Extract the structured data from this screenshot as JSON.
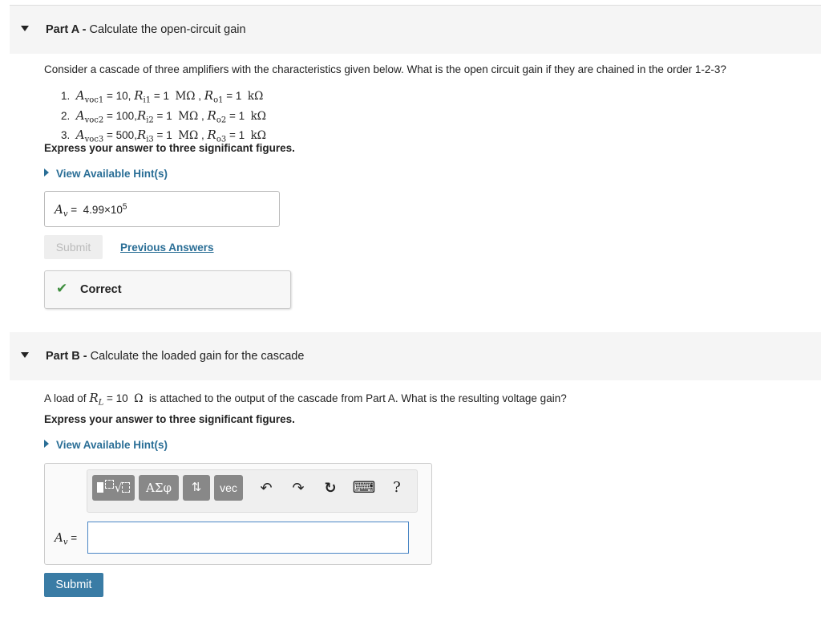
{
  "partA": {
    "label": "Part A",
    "sep": " - ",
    "title": "Calculate the open-circuit gain",
    "question": "Consider a cascade of three amplifiers with the characteristics given below. What is the open circuit gain if they are chained in the order 1-2-3?",
    "items": [
      {
        "num": "1.",
        "avoc_sub": "voc1",
        "avoc_val": "10,",
        "ri_sub": "i1",
        "ri_val": "1",
        "ri_unit": "MΩ",
        "ro_sub": "o1",
        "ro_val": "1",
        "ro_unit": "kΩ"
      },
      {
        "num": "2.",
        "avoc_sub": "voc2",
        "avoc_val": "100,",
        "ri_sub": "i2",
        "ri_val": "1",
        "ri_unit": "MΩ",
        "ro_sub": "o2",
        "ro_val": "1",
        "ro_unit": "kΩ"
      },
      {
        "num": "3.",
        "avoc_sub": "voc3",
        "avoc_val": "500,",
        "ri_sub": "i3",
        "ri_val": "1",
        "ri_unit": "MΩ",
        "ro_sub": "o3",
        "ro_val": "1",
        "ro_unit": "kΩ"
      }
    ],
    "instruction": "Express your answer to three significant figures.",
    "hint_label": "View Available Hint(s)",
    "answer_var": "A",
    "answer_var_sub": "v",
    "answer_eq": "=",
    "answer_mantissa": "4.99×10",
    "answer_exp": "5",
    "submit_label": "Submit",
    "previous_label": "Previous Answers",
    "feedback_label": "Correct"
  },
  "partB": {
    "label": "Part B",
    "sep": " - ",
    "title": "Calculate the loaded gain for the cascade",
    "question_pre": "A load of",
    "rl_var": "R",
    "rl_sub": "L",
    "rl_val": "= 10",
    "rl_unit": "Ω",
    "question_post": "is attached to the output of the cascade from Part A. What is the resulting voltage gain?",
    "instruction": "Express your answer to three significant figures.",
    "hint_label": "View Available Hint(s)",
    "toolbar": {
      "templates": "√",
      "greek": "ΑΣφ",
      "arrows": "⇅",
      "vec": "vec",
      "undo": "↶",
      "redo": "↷",
      "reset": "↻",
      "keyboard": "⌨",
      "help": "?"
    },
    "answer_var": "A",
    "answer_var_sub": "v",
    "answer_eq": "=",
    "answer_value": "",
    "submit_label": "Submit"
  },
  "colors": {
    "link": "#2a6e96",
    "submit": "#3a7ca5",
    "correct": "#3e8e3e",
    "input_border": "#4a86c5"
  }
}
